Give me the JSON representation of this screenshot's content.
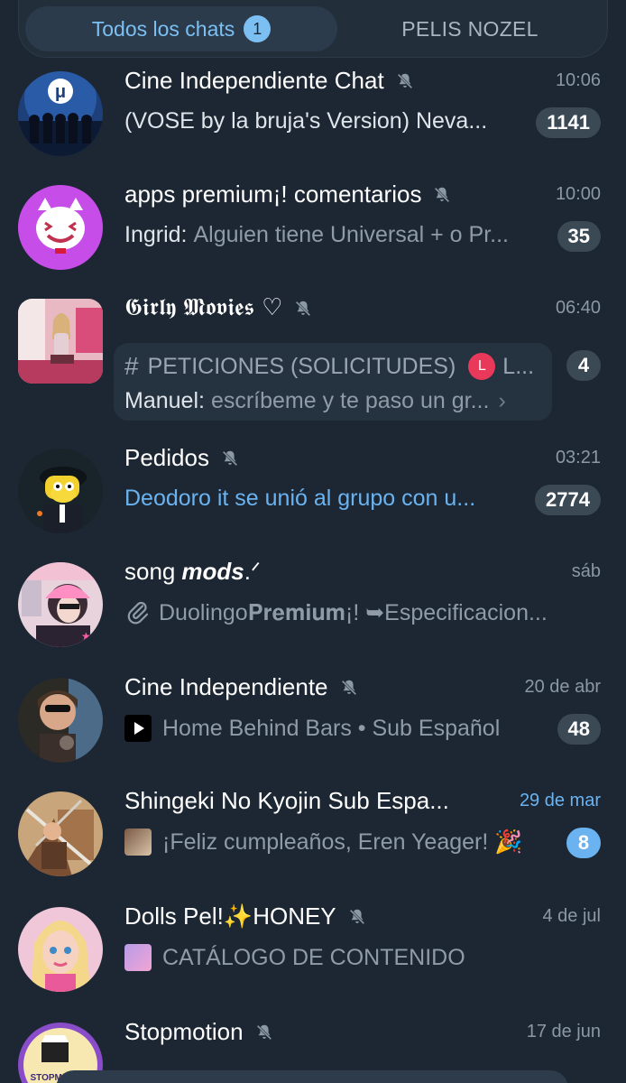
{
  "tabs": {
    "active_label": "Todos los chats",
    "active_count": "1",
    "second_label": "PELIS NOZEL"
  },
  "chats": [
    {
      "title": "Cine Independiente Chat",
      "time": "10:06",
      "preview": "(VOSE by la bruja's Version) Neva...",
      "badge": "1141"
    },
    {
      "title": "apps premium¡! comentarios",
      "time": "10:00",
      "sender": "Ingrid:",
      "preview": "Alguien tiene Universal + o Pr...",
      "badge": "35"
    },
    {
      "title": "𝕲𝖎𝖗𝖑𝖞 𝕸𝖔𝖛𝖎𝖊𝖘 ♡",
      "time": "06:40",
      "topic": "PETICIONES (SOLICITUDES)",
      "topic_tag": "L",
      "topic_tag_after": "L...",
      "sender": "Manuel:",
      "preview": "escríbeme y te paso un gr...",
      "badge": "4"
    },
    {
      "title": "Pedidos",
      "time": "03:21",
      "preview": "Deodoro it se unió al grupo con u...",
      "badge": "2774"
    },
    {
      "title_plain": "song ",
      "title_bold": "mods",
      "title_tail": " .ᐟ",
      "time": "sáb",
      "preview_a": "Duolingo ",
      "preview_b": "𝐏𝐫𝐞𝐦𝐢𝐮𝐦",
      "preview_c": "¡!  ➥Especificacion..."
    },
    {
      "title": "Cine Independiente",
      "time": "20 de abr",
      "preview": "Home Behind Bars • Sub Español",
      "badge": "48"
    },
    {
      "title": "Shingeki No Kyojin Sub Espa...",
      "time": "29 de mar",
      "preview": "¡Feliz cumpleaños, Eren Yeager! 🎉",
      "badge": "8"
    },
    {
      "title": "Dolls Pel!✨HONEY",
      "time": "4 de jul",
      "preview": "CATÁLOGO DE CONTENIDO"
    },
    {
      "title": "Stopmotion",
      "time": "17 de jun"
    }
  ],
  "icons": {
    "mute": "muted-bell-icon",
    "forum": "hash-icon",
    "attachment": "paperclip-icon",
    "play": "play-icon",
    "arrow": "chevron-right-icon"
  },
  "colors": {
    "background": "#1c2733",
    "accent": "#7cc0f3",
    "badge_muted": "#3b4955",
    "text_secondary": "#8f9ca8"
  }
}
